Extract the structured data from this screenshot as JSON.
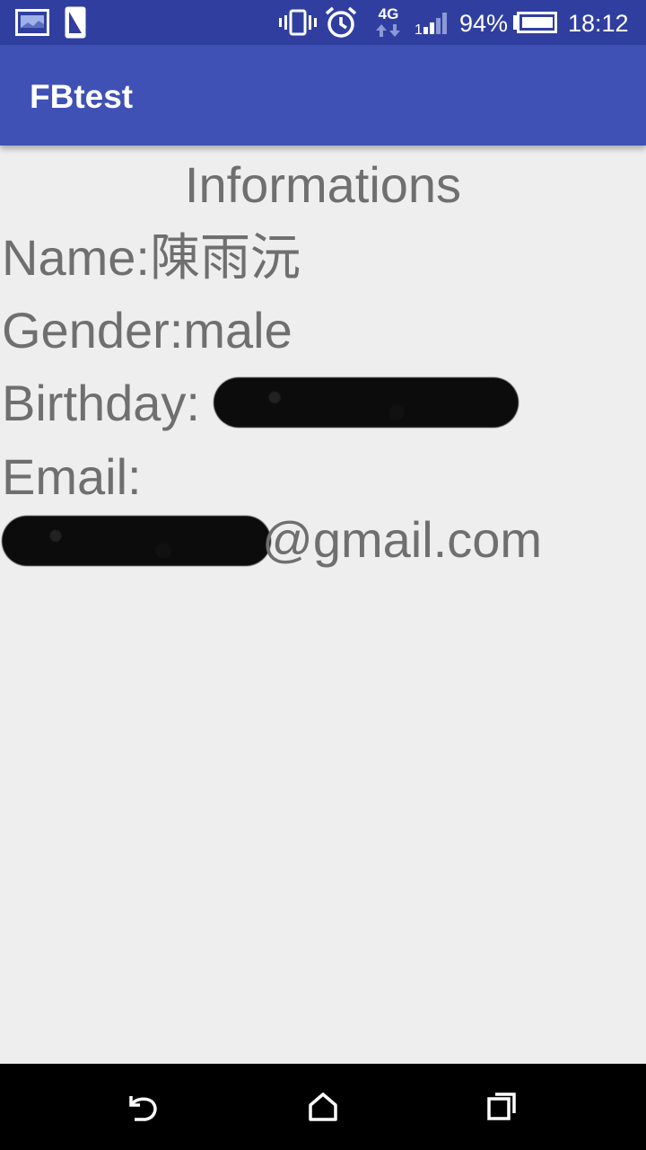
{
  "status_bar": {
    "battery_percent": "94%",
    "time": "18:12",
    "network": "4G",
    "icons": [
      "gallery-icon",
      "sim-card-icon",
      "vibrate-icon",
      "alarm-icon",
      "network-4g-icon",
      "signal-icon",
      "battery-icon"
    ]
  },
  "app_bar": {
    "title": "FBtest"
  },
  "main": {
    "heading": "Informations",
    "name_label": "Name:",
    "name_value": "陳雨沅",
    "gender_label": "Gender:",
    "gender_value": "male",
    "birthday_label": "Birthday:",
    "email_label": "Email:",
    "email_domain": "@gmail.com"
  },
  "nav_bar": {
    "buttons": [
      "back-icon",
      "home-icon",
      "recents-icon"
    ]
  },
  "colors": {
    "status_bar": "#303f9f",
    "app_bar": "#3f51b5",
    "background": "#eeeeee",
    "text": "#6f6f6f",
    "nav_bar": "#000000"
  }
}
